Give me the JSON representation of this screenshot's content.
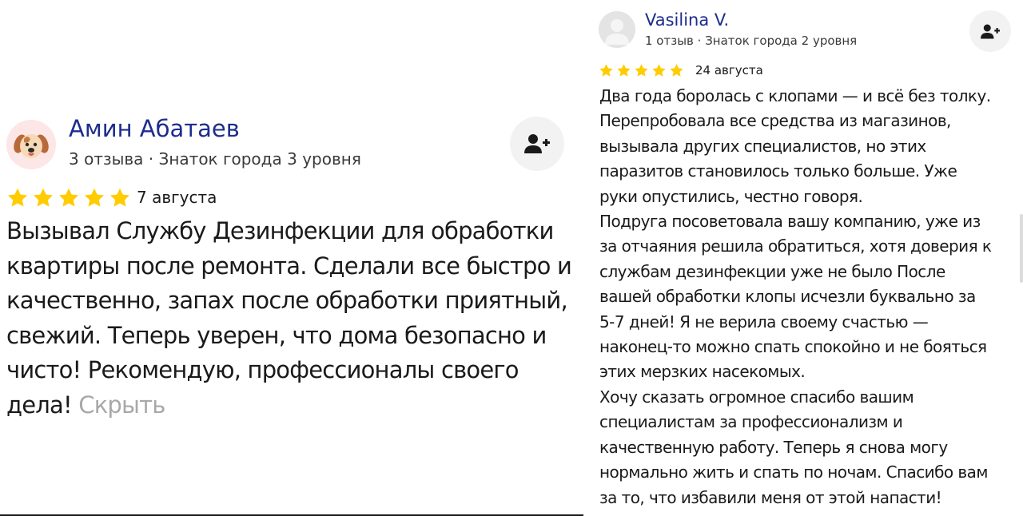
{
  "review_left": {
    "author_name": "Амин Абатаев",
    "author_meta": "3 отзыва · Знаток города 3 уровня",
    "rating": 5,
    "date": "7 августа",
    "text_lines": [
      "Вызывал Службу Дезинфекции для обработки",
      "квартиры после ремонта. Сделали все быстро и",
      "качественно, запах после обработки приятный,",
      "свежий. Теперь уверен, что дома безопасно и",
      "чисто! Рекомендую, профессионалы своего",
      "дела!"
    ],
    "hide_label": "Скрыть",
    "avatar_icon": "puppy-avatar-icon",
    "subscribe_icon": "add-user-icon"
  },
  "review_right": {
    "author_name": "Vasilina V.",
    "author_meta": "1 отзыв · Знаток города 2 уровня",
    "rating": 5,
    "date": "24 августа",
    "text_lines": [
      "Два года боролась с клопами — и всё без толку.",
      "Перепробовала все средства из магазинов,",
      "вызывала других специалистов, но этих",
      "паразитов становилось только больше. Уже",
      "руки опустились, честно говоря.",
      "Подруга посоветовала вашу компанию, уже из",
      "за отчаяния решила обратиться, хотя доверия к",
      "службам дезинфекции уже не было После",
      "вашей обработки клопы исчезли буквально за",
      "5-7 дней! Я не верила своему счастью —",
      "наконец-то можно спать спокойно и не бояться",
      "этих мерзких насекомых.",
      "Хочу сказать огромное спасибо вашим",
      "специалистам за профессионализм и",
      "качественную работу. Теперь я снова могу",
      "нормально жить и спать по ночам. Спасибо вам",
      "за то, что избавили меня от этой напасти!"
    ],
    "avatar_icon": "default-user-avatar-icon",
    "subscribe_icon": "add-user-icon"
  },
  "colors": {
    "author_name": "#1c2d8c",
    "star": "#ffcc00",
    "hide_link": "#a8a8a8",
    "button_bg": "#f2f2f2"
  }
}
